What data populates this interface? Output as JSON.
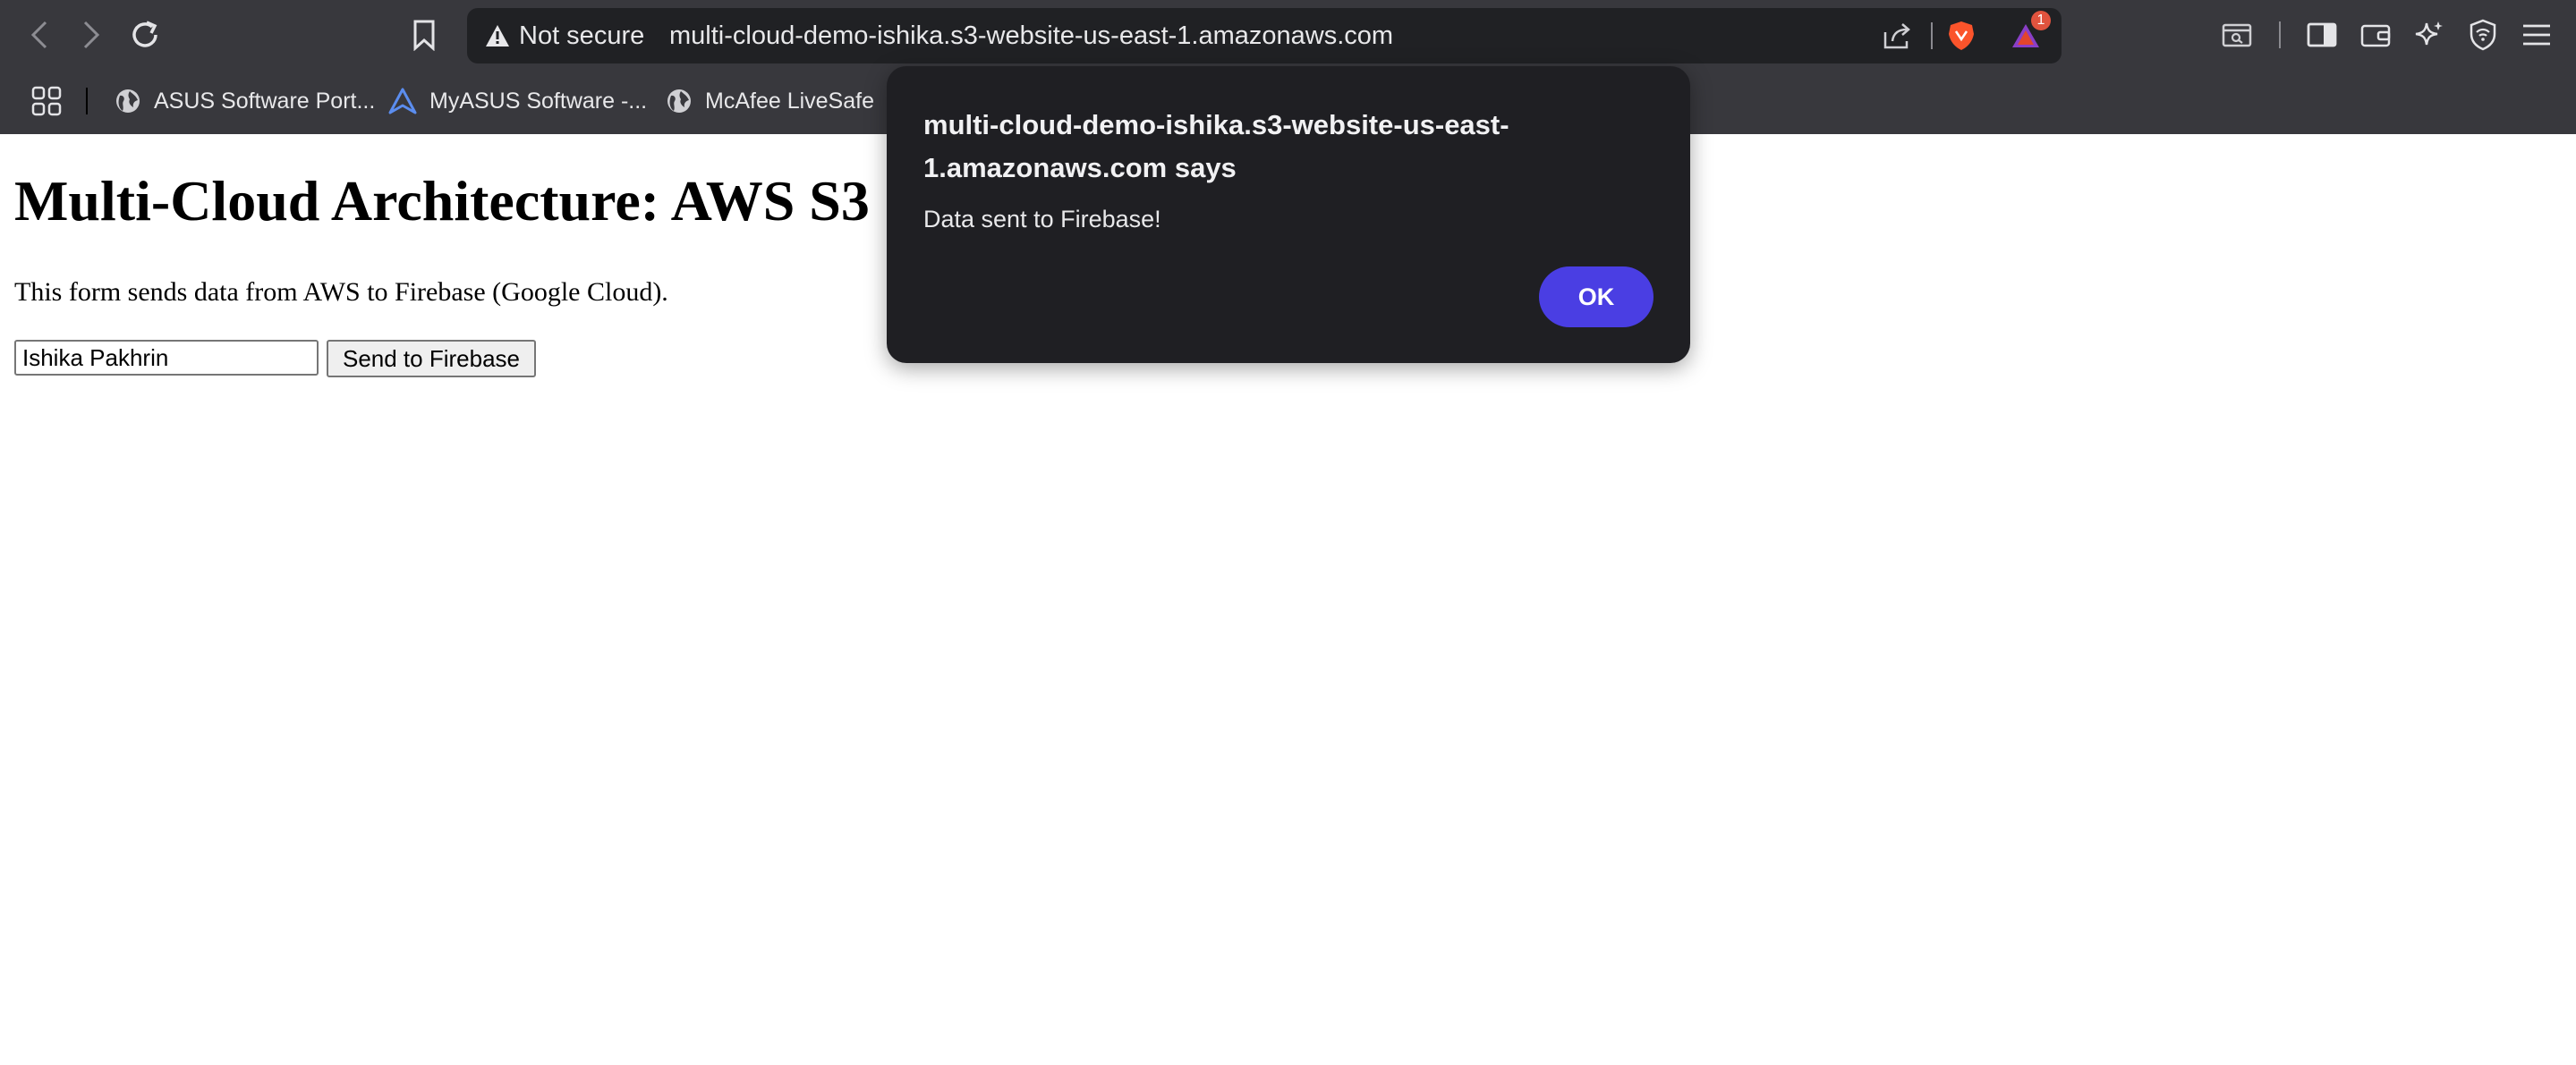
{
  "browser": {
    "security_label": "Not secure",
    "url": "multi-cloud-demo-ishika.s3-website-us-east-1.amazonaws.com",
    "notification_count": "1",
    "bookmarks": [
      {
        "label": "ASUS Software Port...",
        "icon": "globe-icon"
      },
      {
        "label": "MyASUS Software -...",
        "icon": "myasus-logo-icon"
      },
      {
        "label": "McAfee LiveSafe",
        "icon": "globe-icon"
      }
    ]
  },
  "page": {
    "title": "Multi-Cloud Architecture: AWS S3",
    "description": "This form sends data from AWS to Firebase (Google Cloud).",
    "name_input_value": "Ishika Pakhrin",
    "send_button_label": "Send to Firebase"
  },
  "dialog": {
    "title": "multi-cloud-demo-ishika.s3-website-us-east-1.amazonaws.com says",
    "message": "Data sent to Firebase!",
    "ok_label": "OK"
  },
  "colors": {
    "chrome_bg": "#38383d",
    "urlbar_bg": "#202124",
    "dialog_bg": "#1f1f23",
    "ok_button": "#4a3ee3",
    "brave_orange": "#fb542b",
    "badge_red": "#e0533e"
  }
}
